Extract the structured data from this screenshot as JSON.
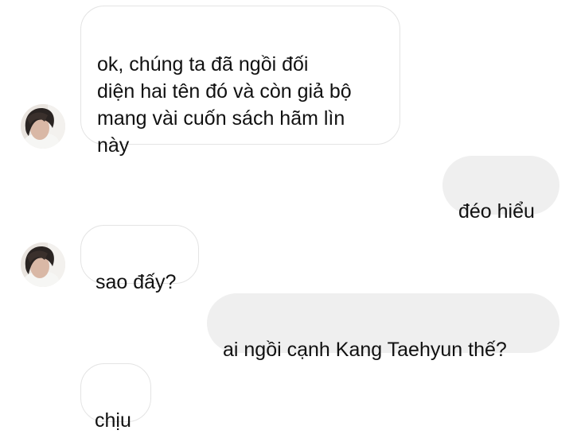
{
  "messages": [
    {
      "sender": "other",
      "text": "ok, chúng ta đã ngồi đối\ndiện hai tên đó và còn giả bộ\nmang vài cuốn sách hãm lìn\nnày",
      "avatar": true
    },
    {
      "sender": "me",
      "text": "đéo hiểu"
    },
    {
      "sender": "other",
      "text": "sao đấy?",
      "avatar": true
    },
    {
      "sender": "me",
      "text": "ai ngồi cạnh Kang Taehyun thế?"
    },
    {
      "sender": "other",
      "text": "chịu"
    }
  ],
  "colors": {
    "incoming_bubble_bg": "#ffffff",
    "incoming_bubble_border": "#e4e4e4",
    "outgoing_bubble_bg": "#efefef",
    "text": "#111111"
  },
  "icons": {
    "avatar": "user-photo-avatar"
  }
}
